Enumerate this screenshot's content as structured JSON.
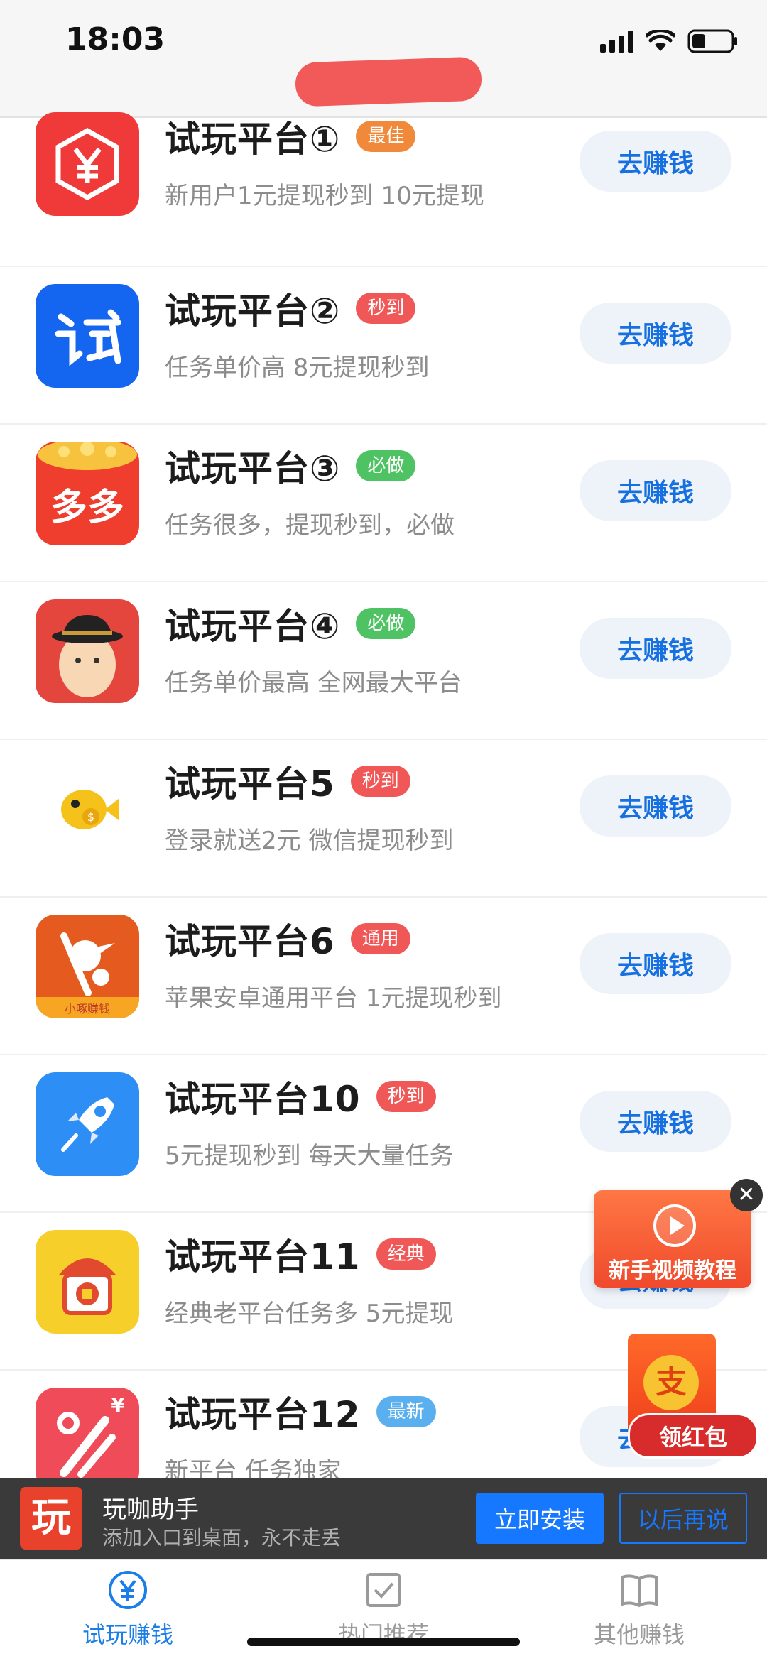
{
  "status_bar": {
    "time": "18:03"
  },
  "list": [
    {
      "title": "试玩平台①",
      "badge": "最佳",
      "badge_color": "#f08a3a",
      "subtitle": "新用户1元提现秒到 10元提现",
      "button": "去赚钱",
      "icon": "yuan-hexagon-icon"
    },
    {
      "title": "试玩平台②",
      "badge": "秒到",
      "badge_color": "#f05757",
      "subtitle": "任务单价高 8元提现秒到",
      "button": "去赚钱",
      "icon": "shi-app-icon"
    },
    {
      "title": "试玩平台③",
      "badge": "必做",
      "badge_color": "#4fc264",
      "subtitle": "任务很多，提现秒到，必做",
      "button": "去赚钱",
      "icon": "duoduo-redpacket-icon"
    },
    {
      "title": "试玩平台④",
      "badge": "必做",
      "badge_color": "#4fc264",
      "subtitle": "任务单价最高 全网最大平台",
      "button": "去赚钱",
      "icon": "man-hat-avatar-icon"
    },
    {
      "title": "试玩平台5",
      "badge": "秒到",
      "badge_color": "#f05757",
      "subtitle": "登录就送2元 微信提现秒到",
      "button": "去赚钱",
      "icon": "gold-fish-icon"
    },
    {
      "title": "试玩平台6",
      "badge": "通用",
      "badge_color": "#f05757",
      "subtitle": "苹果安卓通用平台 1元提现秒到",
      "button": "去赚钱",
      "icon": "woodpecker-icon",
      "icon_caption": "小啄赚钱"
    },
    {
      "title": "试玩平台10",
      "badge": "秒到",
      "badge_color": "#f05757",
      "subtitle": "5元提现秒到 每天大量任务",
      "button": "去赚钱",
      "icon": "rocket-icon"
    },
    {
      "title": "试玩平台11",
      "badge": "经典",
      "badge_color": "#f05757",
      "subtitle": "经典老平台任务多 5元提现",
      "button": "去赚钱",
      "icon": "gate-coin-icon"
    },
    {
      "title": "试玩平台12",
      "badge": "最新",
      "badge_color": "#5ab0ee",
      "subtitle": "新平台 任务独家",
      "button": "去赚钱",
      "icon": "percent-yuan-icon"
    }
  ],
  "float_video": {
    "label": "新手视频教程"
  },
  "float_redpacket": {
    "label": "领红包",
    "coin": "支"
  },
  "install_banner": {
    "logo": "玩",
    "name": "玩咖助手",
    "desc": "添加入口到桌面，永不走丢",
    "install_button": "立即安装",
    "later_button": "以后再说"
  },
  "tabbar": [
    {
      "label": "试玩赚钱",
      "icon": "yuan-circle-icon",
      "active": true,
      "color": "#1a7de8"
    },
    {
      "label": "热门推荐",
      "icon": "checkbox-icon",
      "active": false,
      "color": "#9a9a9a"
    },
    {
      "label": "其他赚钱",
      "icon": "book-icon",
      "active": false,
      "color": "#9a9a9a"
    }
  ]
}
